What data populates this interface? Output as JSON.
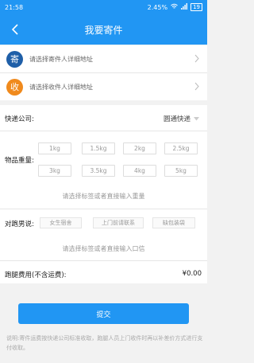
{
  "status_bar": {
    "time": "21:58",
    "network": "2.45%",
    "battery": "19"
  },
  "nav": {
    "title": "我要寄件"
  },
  "sender": {
    "badge": "寄",
    "placeholder": "请选择寄件人详细地址"
  },
  "receiver": {
    "badge": "收",
    "placeholder": "请选择收件人详细地址"
  },
  "courier": {
    "label": "快递公司:",
    "value": "圆通快递"
  },
  "weight": {
    "label": "物品重量:",
    "options": [
      "1kg",
      "1.5kg",
      "2kg",
      "2.5kg",
      "3kg",
      "3.5kg",
      "4kg",
      "5kg"
    ],
    "hint": "请选择标签或者直接输入重量"
  },
  "runner_note": {
    "label": "对跑男说:",
    "tags": [
      "女生宿舍",
      "上门前请联系",
      "缺包装袋"
    ],
    "hint": "请选择标签或者直接输入口信"
  },
  "fee": {
    "label": "跑腿费用(不含运费):",
    "value": "¥0.00"
  },
  "submit_label": "提交",
  "footer_note": "说明:寄件运费按快递公司标准收取，跑腿人员上门收件时再以补差价方式进行支付收取。",
  "colors": {
    "primary": "#2196f3",
    "sender_badge": "#1f5fa8",
    "receiver_badge": "#f08a1d"
  }
}
